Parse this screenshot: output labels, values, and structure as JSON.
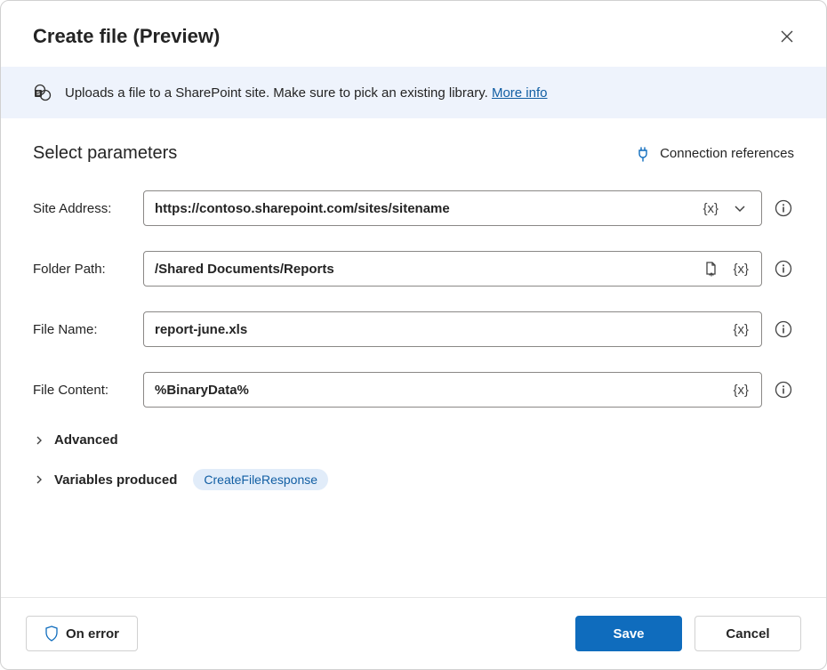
{
  "header": {
    "title": "Create file (Preview)"
  },
  "banner": {
    "text": "Uploads a file to a SharePoint site. Make sure to pick an existing library. ",
    "link_text": "More info"
  },
  "params": {
    "title": "Select parameters",
    "conn_refs": "Connection references",
    "fields": {
      "site_address": {
        "label": "Site Address:",
        "value": "https://contoso.sharepoint.com/sites/sitename"
      },
      "folder_path": {
        "label": "Folder Path:",
        "value": "/Shared Documents/Reports"
      },
      "file_name": {
        "label": "File Name:",
        "value": "report-june.xls"
      },
      "file_content": {
        "label": "File Content:",
        "value": "%BinaryData%"
      }
    },
    "var_token": "{x}"
  },
  "sections": {
    "advanced": "Advanced",
    "variables_produced": "Variables produced",
    "variables_chip": "CreateFileResponse"
  },
  "footer": {
    "on_error": "On error",
    "save": "Save",
    "cancel": "Cancel"
  }
}
